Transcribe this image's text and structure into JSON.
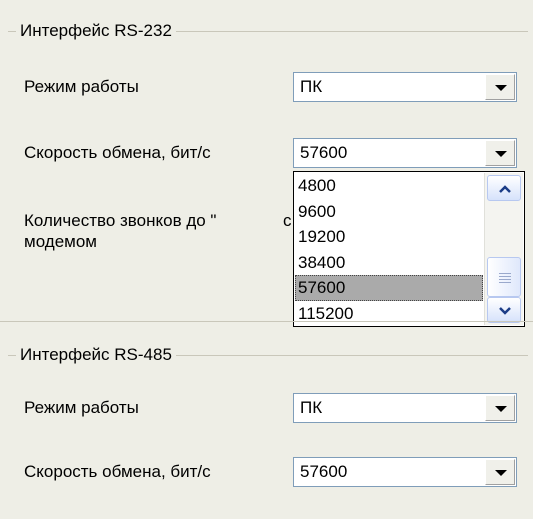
{
  "rs232": {
    "title": "Интерфейс RS-232",
    "mode_label": "Режим работы",
    "mode_value": "ПК",
    "speed_label": "Скорость обмена, бит/с",
    "speed_value": "57600",
    "rings_label_line1": "Количество звонков до \"с",
    "rings_label_partial": "с",
    "rings_label_line2": "модемом"
  },
  "dropdown": {
    "options": [
      "4800",
      "9600",
      "19200",
      "38400",
      "57600",
      "115200"
    ],
    "selected": "57600",
    "scroll_position": 0.9
  },
  "rs485": {
    "title": "Интерфейс RS-485",
    "mode_label": "Режим работы",
    "mode_value": "ПК",
    "speed_label": "Скорость обмена, бит/с",
    "speed_value": "57600"
  },
  "icons": {
    "combo_arrow": "chevron-down-icon",
    "scroll_up": "scroll-up-icon",
    "scroll_down": "scroll-down-icon"
  }
}
